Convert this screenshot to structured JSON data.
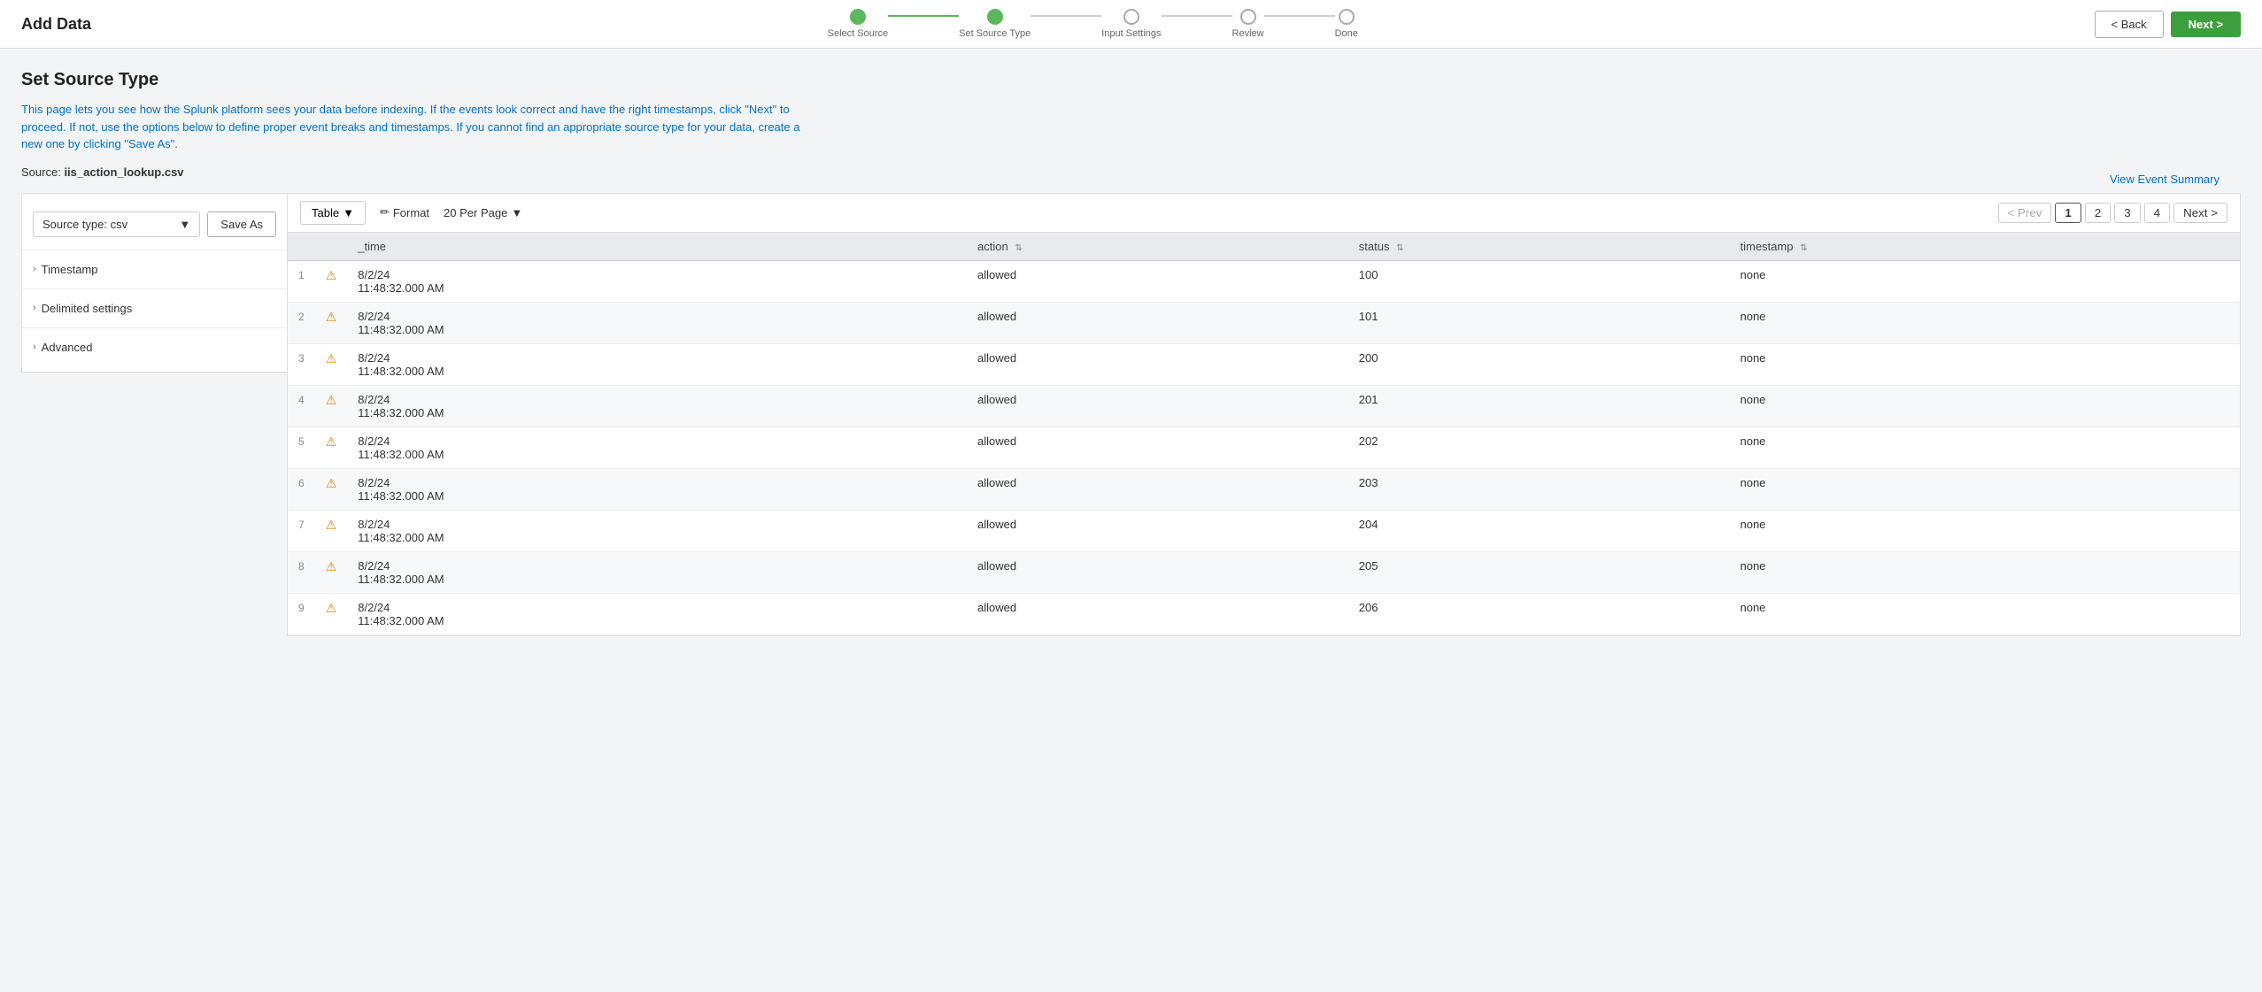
{
  "header": {
    "title": "Add Data",
    "back_label": "< Back",
    "next_label": "Next >"
  },
  "wizard": {
    "steps": [
      {
        "label": "Select Source",
        "state": "completed"
      },
      {
        "label": "Set Source Type",
        "state": "active"
      },
      {
        "label": "Input Settings",
        "state": "inactive"
      },
      {
        "label": "Review",
        "state": "inactive"
      },
      {
        "label": "Done",
        "state": "inactive"
      }
    ]
  },
  "page": {
    "title": "Set Source Type",
    "description": "This page lets you see how the Splunk platform sees your data before indexing. If the events look correct and have the right timestamps, click \"Next\" to proceed. If not, use the options below to define proper event breaks and timestamps. If you cannot find an appropriate source type for your data, create a new one by clicking \"Save As\".",
    "source_label": "Source:",
    "source_value": "iis_action_lookup.csv",
    "view_event_summary": "View Event Summary"
  },
  "left_panel": {
    "source_type_label": "Source type: csv",
    "source_type_dropdown_arrow": "▼",
    "save_as_label": "Save As",
    "sections": [
      {
        "label": "Timestamp"
      },
      {
        "label": "Delimited settings"
      },
      {
        "label": "Advanced"
      }
    ]
  },
  "table_toolbar": {
    "table_label": "Table",
    "table_arrow": "▼",
    "format_icon": "✏",
    "format_label": "Format",
    "per_page_label": "20 Per Page",
    "per_page_arrow": "▼"
  },
  "pagination": {
    "prev_label": "< Prev",
    "next_label": "Next >",
    "pages": [
      "1",
      "2",
      "3",
      "4"
    ],
    "current_page": "1"
  },
  "table": {
    "columns": [
      {
        "key": "num",
        "label": ""
      },
      {
        "key": "warn",
        "label": ""
      },
      {
        "key": "_time",
        "label": "_time"
      },
      {
        "key": "action",
        "label": "action",
        "sortable": true
      },
      {
        "key": "status",
        "label": "status",
        "sortable": true
      },
      {
        "key": "timestamp",
        "label": "timestamp",
        "sortable": true
      }
    ],
    "rows": [
      {
        "num": 1,
        "time": "8/2/24\n11:48:32.000 AM",
        "action": "allowed",
        "status": "100",
        "timestamp": "none"
      },
      {
        "num": 2,
        "time": "8/2/24\n11:48:32.000 AM",
        "action": "allowed",
        "status": "101",
        "timestamp": "none"
      },
      {
        "num": 3,
        "time": "8/2/24\n11:48:32.000 AM",
        "action": "allowed",
        "status": "200",
        "timestamp": "none"
      },
      {
        "num": 4,
        "time": "8/2/24\n11:48:32.000 AM",
        "action": "allowed",
        "status": "201",
        "timestamp": "none"
      },
      {
        "num": 5,
        "time": "8/2/24\n11:48:32.000 AM",
        "action": "allowed",
        "status": "202",
        "timestamp": "none"
      },
      {
        "num": 6,
        "time": "8/2/24\n11:48:32.000 AM",
        "action": "allowed",
        "status": "203",
        "timestamp": "none"
      },
      {
        "num": 7,
        "time": "8/2/24\n11:48:32.000 AM",
        "action": "allowed",
        "status": "204",
        "timestamp": "none"
      },
      {
        "num": 8,
        "time": "8/2/24\n11:48:32.000 AM",
        "action": "allowed",
        "status": "205",
        "timestamp": "none"
      },
      {
        "num": 9,
        "time": "8/2/24\n11:48:32.000 AM",
        "action": "allowed",
        "status": "206",
        "timestamp": "none"
      }
    ]
  }
}
